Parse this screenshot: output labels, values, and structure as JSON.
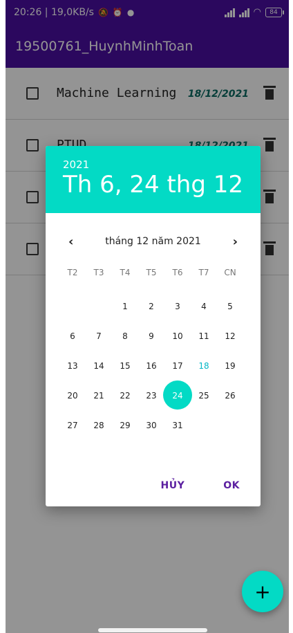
{
  "status_bar": {
    "time_speed": "20:26 | 19,0KB/s",
    "battery": "84"
  },
  "app": {
    "title": "19500761_HuynhMinhToan"
  },
  "list": [
    {
      "name": "Machine Learning",
      "date": "18/12/2021"
    },
    {
      "name": "PTUD",
      "date": "18/12/2021"
    },
    {
      "name": "",
      "date": ""
    },
    {
      "name": "",
      "date": ""
    }
  ],
  "date_picker": {
    "year": "2021",
    "selected_date_label": "Th 6, 24 thg 12",
    "month_title": "tháng 12 năm 2021",
    "weekdays": [
      "T2",
      "T3",
      "T4",
      "T5",
      "T6",
      "T7",
      "CN"
    ],
    "days_grid": [
      "",
      "",
      "1",
      "2",
      "3",
      "4",
      "5",
      "6",
      "7",
      "8",
      "9",
      "10",
      "11",
      "12",
      "13",
      "14",
      "15",
      "16",
      "17",
      "18",
      "19",
      "20",
      "21",
      "22",
      "23",
      "24",
      "25",
      "26",
      "27",
      "28",
      "29",
      "30",
      "31"
    ],
    "today": "18",
    "selected_day": "24",
    "cancel_label": "HỦY",
    "ok_label": "OK"
  },
  "fab": {
    "label": "+"
  },
  "colors": {
    "primary": "#4b0fa3",
    "accent": "#03dac5",
    "date_text": "#0c6b63"
  }
}
